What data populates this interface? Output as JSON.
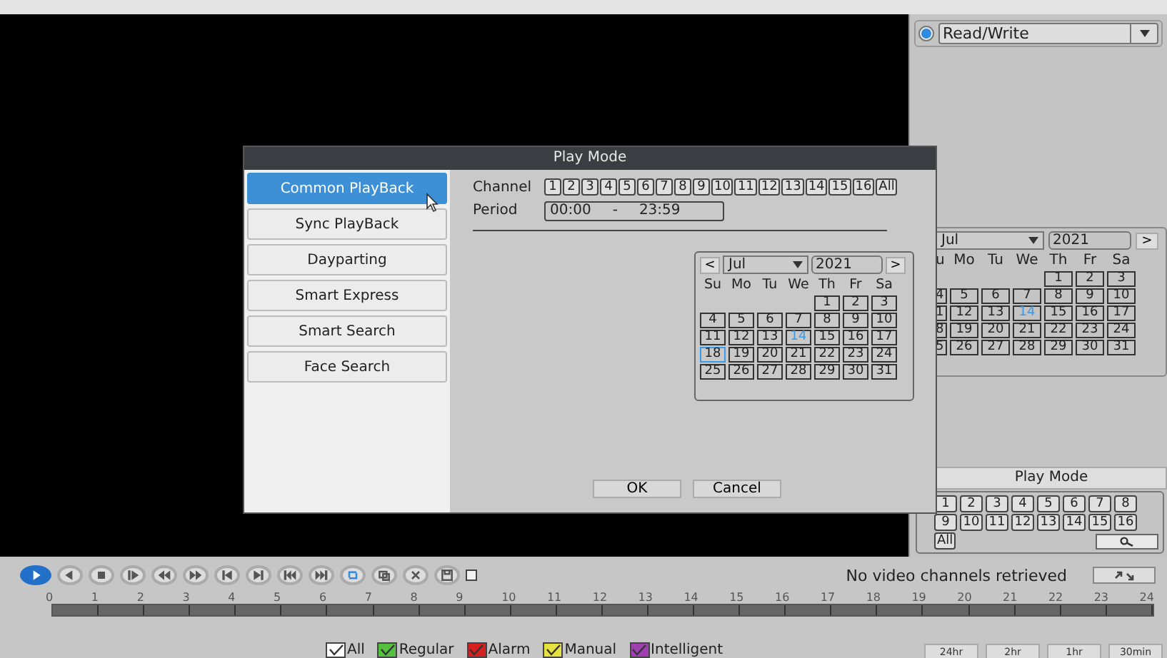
{
  "storage": {
    "selected": true,
    "mode": "Read/Write"
  },
  "side_calendar": {
    "month": "Jul",
    "year": "2021",
    "next": ">",
    "weekdays": [
      "u",
      "Mo",
      "Tu",
      "We",
      "Th",
      "Fr",
      "Sa"
    ],
    "weeks": [
      [
        {
          "d": "1",
          "today": false
        },
        {
          "d": "2",
          "today": false
        },
        {
          "d": "3",
          "today": false
        }
      ],
      [
        {
          "d": "4",
          "today": false
        },
        {
          "d": "5",
          "today": false
        },
        {
          "d": "6",
          "today": false
        },
        {
          "d": "7",
          "today": false
        },
        {
          "d": "8",
          "today": false
        },
        {
          "d": "9",
          "today": false
        },
        {
          "d": "10",
          "today": false
        }
      ],
      [
        {
          "d": "1",
          "today": false
        },
        {
          "d": "12",
          "today": false
        },
        {
          "d": "13",
          "today": false
        },
        {
          "d": "14",
          "today": true
        },
        {
          "d": "15",
          "today": false
        },
        {
          "d": "16",
          "today": false
        },
        {
          "d": "17",
          "today": false
        }
      ],
      [
        {
          "d": "8",
          "today": false
        },
        {
          "d": "19",
          "today": false
        },
        {
          "d": "20",
          "today": false
        },
        {
          "d": "21",
          "today": false
        },
        {
          "d": "22",
          "today": false
        },
        {
          "d": "23",
          "today": false
        },
        {
          "d": "24",
          "today": false
        }
      ],
      [
        {
          "d": "5",
          "today": false
        },
        {
          "d": "26",
          "today": false
        },
        {
          "d": "27",
          "today": false
        },
        {
          "d": "28",
          "today": false
        },
        {
          "d": "29",
          "today": false
        },
        {
          "d": "30",
          "today": false
        },
        {
          "d": "31",
          "today": false
        }
      ]
    ]
  },
  "side_play_mode": {
    "title": "Play Mode",
    "channels": [
      "1",
      "2",
      "3",
      "4",
      "5",
      "6",
      "7",
      "8",
      "9",
      "10",
      "11",
      "12",
      "13",
      "14",
      "15",
      "16"
    ],
    "all": "All"
  },
  "dialog": {
    "title": "Play Mode",
    "modes": [
      {
        "label": "Common PlayBack",
        "selected": true
      },
      {
        "label": "Sync PlayBack",
        "selected": false
      },
      {
        "label": "Dayparting",
        "selected": false
      },
      {
        "label": "Smart Express",
        "selected": false
      },
      {
        "label": "Smart Search",
        "selected": false
      },
      {
        "label": "Face Search",
        "selected": false
      }
    ],
    "channel_label": "Channel",
    "channels": [
      "1",
      "2",
      "3",
      "4",
      "5",
      "6",
      "7",
      "8",
      "9",
      "10",
      "11",
      "12",
      "13",
      "14",
      "15",
      "16"
    ],
    "all": "All",
    "period_label": "Period",
    "period_start": "00:00",
    "period_sep": "-",
    "period_end": "23:59",
    "calendar": {
      "prev": "<",
      "month": "Jul",
      "year": "2021",
      "next": ">",
      "weekdays": [
        "Su",
        "Mo",
        "Tu",
        "We",
        "Th",
        "Fr",
        "Sa"
      ],
      "weeks": [
        [
          {
            "d": "1",
            "today": false,
            "selected": false
          },
          {
            "d": "2",
            "today": false,
            "selected": false
          },
          {
            "d": "3",
            "today": false,
            "selected": false
          }
        ],
        [
          {
            "d": "4",
            "today": false,
            "selected": false
          },
          {
            "d": "5",
            "today": false,
            "selected": false
          },
          {
            "d": "6",
            "today": false,
            "selected": false
          },
          {
            "d": "7",
            "today": false,
            "selected": false
          },
          {
            "d": "8",
            "today": false,
            "selected": false
          },
          {
            "d": "9",
            "today": false,
            "selected": false
          },
          {
            "d": "10",
            "today": false,
            "selected": false
          }
        ],
        [
          {
            "d": "11",
            "today": false,
            "selected": false
          },
          {
            "d": "12",
            "today": false,
            "selected": false
          },
          {
            "d": "13",
            "today": false,
            "selected": false
          },
          {
            "d": "14",
            "today": true,
            "selected": false
          },
          {
            "d": "15",
            "today": false,
            "selected": false
          },
          {
            "d": "16",
            "today": false,
            "selected": false
          },
          {
            "d": "17",
            "today": false,
            "selected": false
          }
        ],
        [
          {
            "d": "18",
            "today": false,
            "selected": true
          },
          {
            "d": "19",
            "today": false,
            "selected": false
          },
          {
            "d": "20",
            "today": false,
            "selected": false
          },
          {
            "d": "21",
            "today": false,
            "selected": false
          },
          {
            "d": "22",
            "today": false,
            "selected": false
          },
          {
            "d": "23",
            "today": false,
            "selected": false
          },
          {
            "d": "24",
            "today": false,
            "selected": false
          }
        ],
        [
          {
            "d": "25",
            "today": false,
            "selected": false
          },
          {
            "d": "26",
            "today": false,
            "selected": false
          },
          {
            "d": "27",
            "today": false,
            "selected": false
          },
          {
            "d": "28",
            "today": false,
            "selected": false
          },
          {
            "d": "29",
            "today": false,
            "selected": false
          },
          {
            "d": "30",
            "today": false,
            "selected": false
          },
          {
            "d": "31",
            "today": false,
            "selected": false
          }
        ]
      ]
    },
    "buttons": [
      "OK",
      "Cancel"
    ]
  },
  "controls": [
    {
      "kind": "play",
      "active": true
    },
    {
      "kind": "reverse",
      "active": false
    },
    {
      "kind": "stop",
      "active": false
    },
    {
      "kind": "slow",
      "active": false
    },
    {
      "kind": "rewind",
      "active": false
    },
    {
      "kind": "fast_forward",
      "active": false
    },
    {
      "kind": "prev_frame",
      "active": false
    },
    {
      "kind": "next_frame",
      "active": false
    },
    {
      "kind": "prev_file",
      "active": false
    },
    {
      "kind": "next_file",
      "active": false
    },
    {
      "kind": "loop",
      "active": false
    },
    {
      "kind": "clip",
      "active": false
    },
    {
      "kind": "delete",
      "active": false
    },
    {
      "kind": "save",
      "active": false
    }
  ],
  "sync_checkbox": {
    "checked": false
  },
  "status": "No video channels retrieved",
  "timeline_ticks": [
    "0",
    "1",
    "2",
    "3",
    "4",
    "5",
    "6",
    "7",
    "8",
    "9",
    "10",
    "11",
    "12",
    "13",
    "14",
    "15",
    "16",
    "17",
    "18",
    "19",
    "20",
    "21",
    "22",
    "23",
    "24"
  ],
  "legend": [
    {
      "label": "All",
      "color": "#ffffff",
      "checked": true
    },
    {
      "label": "Regular",
      "color": "#55c040",
      "checked": true
    },
    {
      "label": "Alarm",
      "color": "#d42020",
      "checked": true
    },
    {
      "label": "Manual",
      "color": "#e6e040",
      "checked": true
    },
    {
      "label": "Intelligent",
      "color": "#a040b0",
      "checked": true
    }
  ],
  "zoom_buttons": [
    "24hr",
    "2hr",
    "1hr",
    "30min"
  ]
}
